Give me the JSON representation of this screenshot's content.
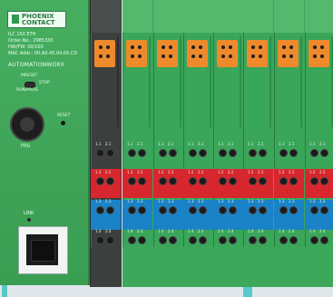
{
  "brand": {
    "line1": "PHOENIX",
    "line2": "CONTACT"
  },
  "device_info": {
    "model": "ILC 150 ETH",
    "order_no": "Order-No.: 2985330",
    "hw_fw": "HW/FW: 00/100",
    "mac": "MAC Addr.: 00.A0.45.04.05.CD"
  },
  "series_label": "AUTOMATIONWORX",
  "switch": {
    "mreset": "MRESET",
    "stop": "STOP",
    "run_prog": "RUN/PROG"
  },
  "reset_label": "RESET",
  "prg_label": "PRG",
  "link_label": "LINK",
  "terminal_rows": [
    [
      "1.1",
      "2.1"
    ],
    [
      "1.2",
      "2.2"
    ],
    [
      "1.3",
      "2.3"
    ],
    [
      "1.4",
      "2.4"
    ]
  ],
  "colors": {
    "module_green": "#3aa65a",
    "orange_led_block": "#ef8a2c",
    "red_band": "#d7262e",
    "blue_band": "#1a82c6",
    "rail_color": "#5ac9c9"
  },
  "icons": [
    "phoenix-logo-icon",
    "mode-switch-icon",
    "ps2-connector-icon",
    "reset-button-icon",
    "ethernet-port-icon"
  ]
}
